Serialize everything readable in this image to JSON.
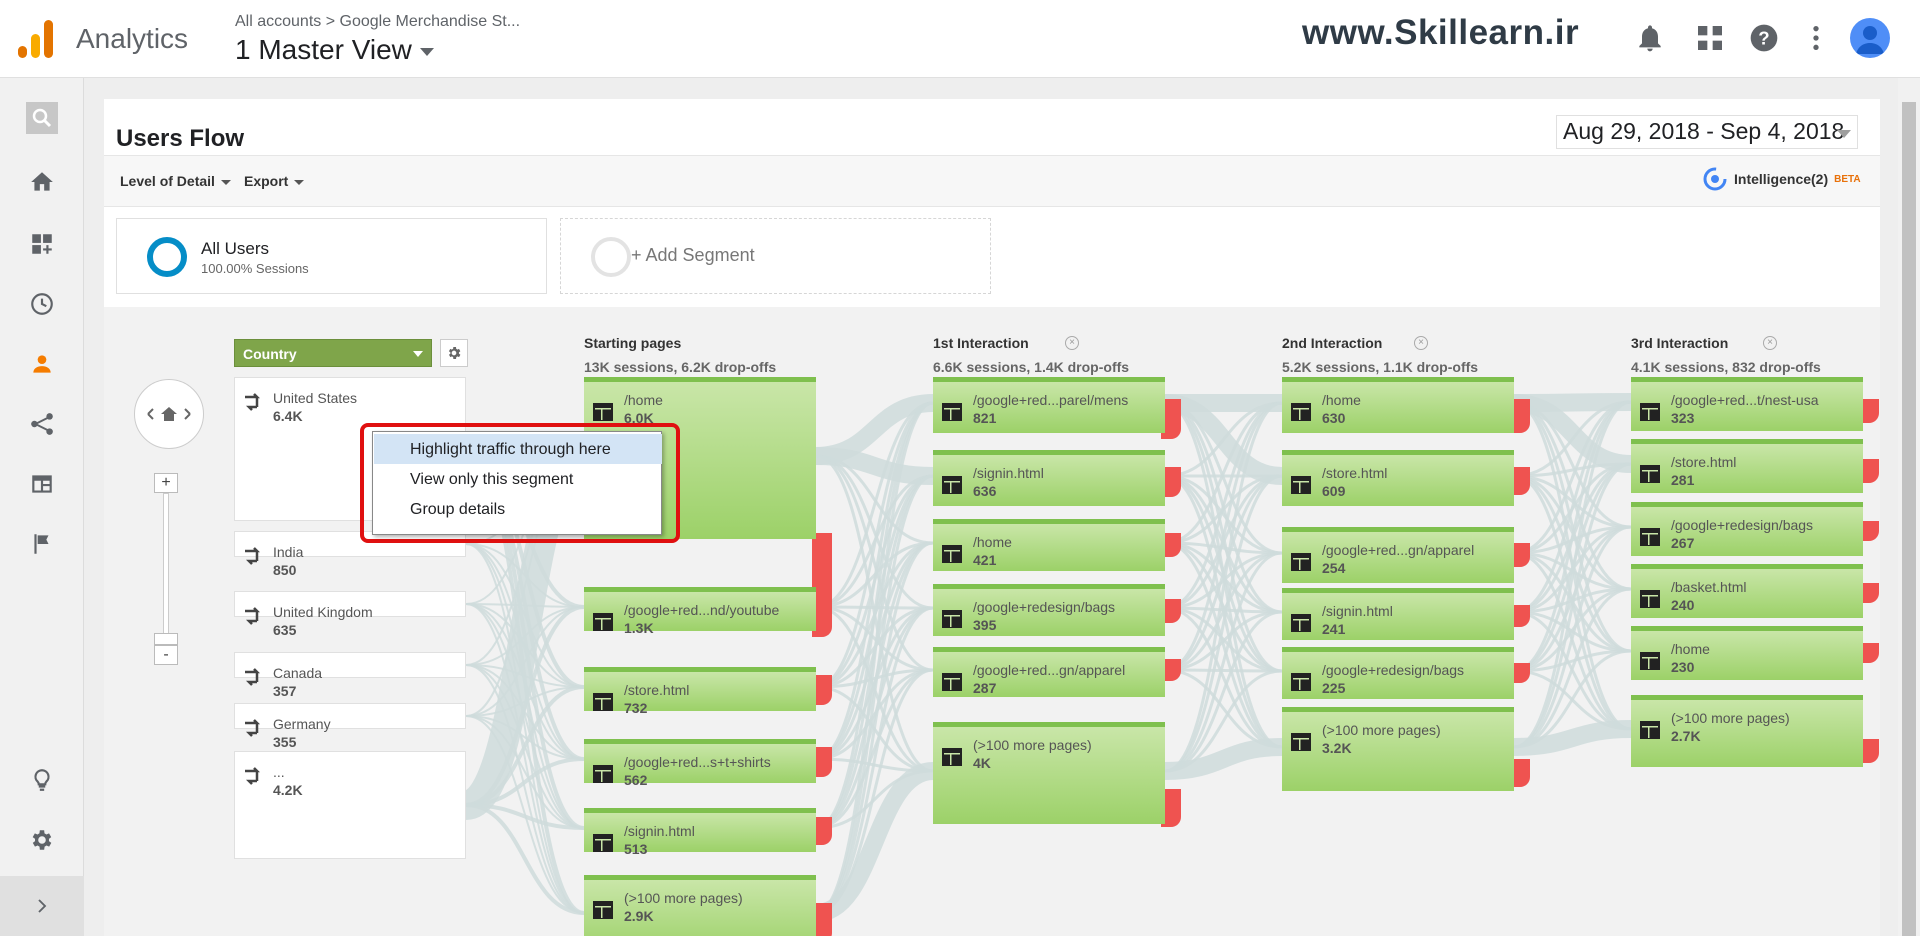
{
  "header": {
    "app_name": "Analytics",
    "breadcrumb": "All accounts  >  Google Merchandise St...",
    "view": "1 Master View",
    "watermark": "www.Skillearn.ir"
  },
  "report": {
    "title": "Users Flow",
    "date_range": "Aug 29, 2018 - Sep 4, 2018",
    "toolbar": {
      "level_of_detail": "Level of Detail",
      "export": "Export",
      "intelligence": "Intelligence(2)",
      "beta": "BETA"
    }
  },
  "segments": {
    "all": {
      "name": "All Users",
      "sub": "100.00% Sessions"
    },
    "add": {
      "name": "+ Add Segment"
    }
  },
  "flow": {
    "dimension": "Country",
    "columns": [
      {
        "title": "Starting pages",
        "sub": "13K sessions, 6.2K drop-offs"
      },
      {
        "title": "1st Interaction",
        "sub": "6.6K sessions, 1.4K drop-offs"
      },
      {
        "title": "2nd Interaction",
        "sub": "5.2K sessions, 1.1K drop-offs"
      },
      {
        "title": "3rd Interaction",
        "sub": "4.1K sessions, 832 drop-offs"
      }
    ],
    "countries": [
      {
        "label": "United States",
        "value": "6.4K"
      },
      {
        "label": "India",
        "value": "850"
      },
      {
        "label": "United Kingdom",
        "value": "635"
      },
      {
        "label": "Canada",
        "value": "357"
      },
      {
        "label": "Germany",
        "value": "355"
      },
      {
        "label": "...",
        "value": "4.2K"
      }
    ],
    "starting": [
      {
        "label": "/home",
        "value": "6.0K"
      },
      {
        "label": "/google+red...nd/youtube",
        "value": "1.3K"
      },
      {
        "label": "/store.html",
        "value": "732"
      },
      {
        "label": "/google+red...s+t+shirts",
        "value": "562"
      },
      {
        "label": "/signin.html",
        "value": "513"
      },
      {
        "label": "(>100 more pages)",
        "value": "2.9K"
      }
    ],
    "first": [
      {
        "label": "/google+red...parel/mens",
        "value": "821"
      },
      {
        "label": "/signin.html",
        "value": "636"
      },
      {
        "label": "/home",
        "value": "421"
      },
      {
        "label": "/google+redesign/bags",
        "value": "395"
      },
      {
        "label": "/google+red...gn/apparel",
        "value": "287"
      },
      {
        "label": "(>100 more pages)",
        "value": "4K"
      }
    ],
    "second": [
      {
        "label": "/home",
        "value": "630"
      },
      {
        "label": "/store.html",
        "value": "609"
      },
      {
        "label": "/google+red...gn/apparel",
        "value": "254"
      },
      {
        "label": "/signin.html",
        "value": "241"
      },
      {
        "label": "/google+redesign/bags",
        "value": "225"
      },
      {
        "label": "(>100 more pages)",
        "value": "3.2K"
      }
    ],
    "third": [
      {
        "label": "/google+red...t/nest-usa",
        "value": "323"
      },
      {
        "label": "/store.html",
        "value": "281"
      },
      {
        "label": "/google+redesign/bags",
        "value": "267"
      },
      {
        "label": "/basket.html",
        "value": "240"
      },
      {
        "label": "/home",
        "value": "230"
      },
      {
        "label": "(>100 more pages)",
        "value": "2.7K"
      }
    ]
  },
  "context_menu": {
    "items": [
      "Highlight traffic through here",
      "View only this segment",
      "Group details"
    ]
  },
  "colors": {
    "node_green": "#9cd168",
    "drop_red": "#ef5350",
    "accent": "#f57c00",
    "segment_blue": "#058dc7"
  }
}
